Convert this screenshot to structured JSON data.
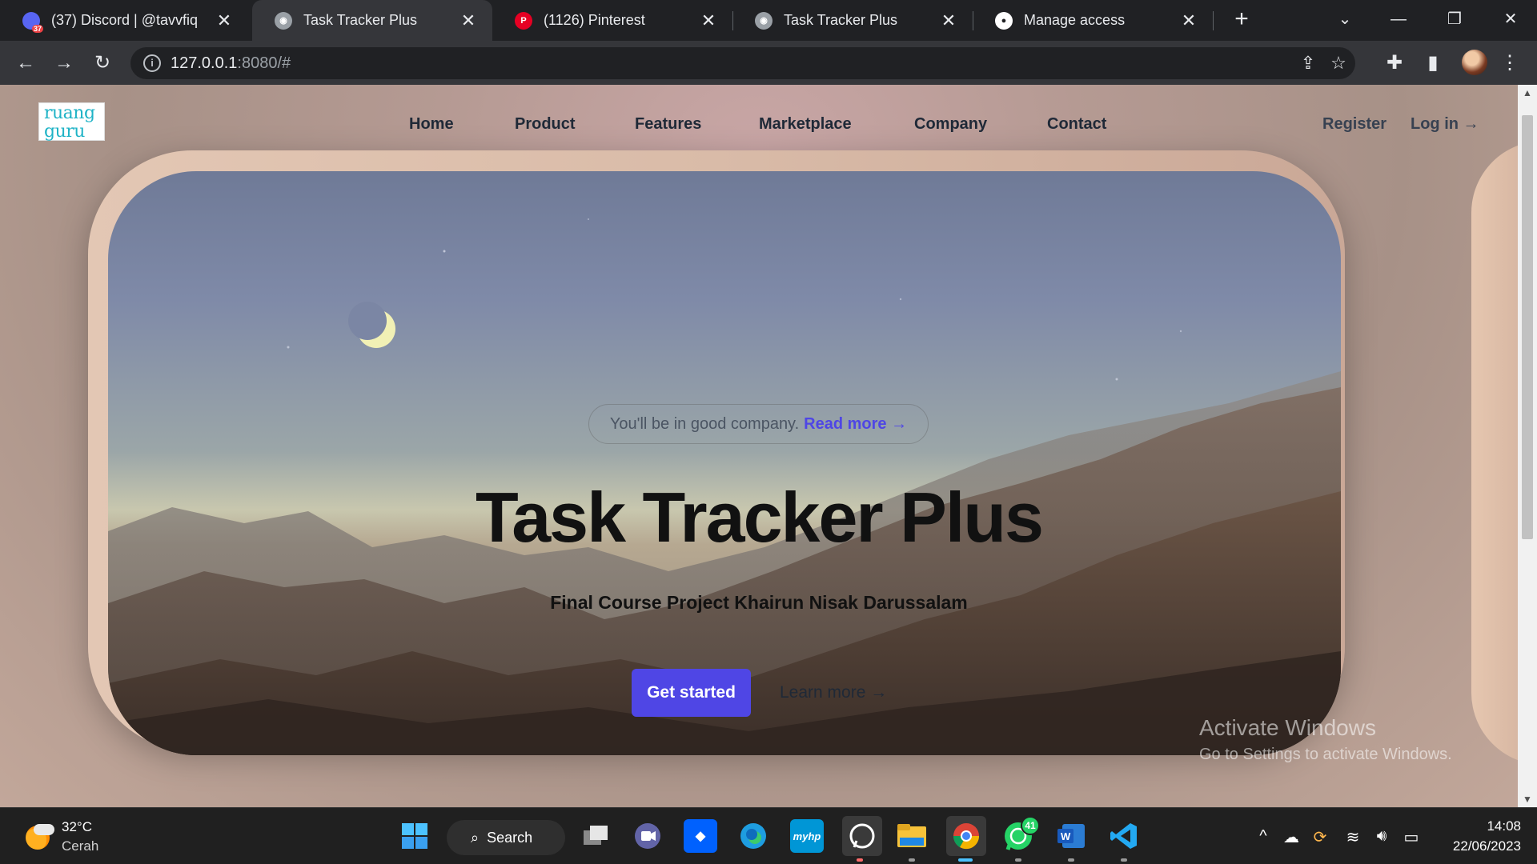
{
  "browser": {
    "tabs": [
      {
        "title": "(37) Discord | @tavvfiq",
        "favicon_badge": "37",
        "favicon_color": "#5865f2"
      },
      {
        "title": "Task Tracker Plus",
        "favicon_color": "#9aa0a6"
      },
      {
        "title": "(1126) Pinterest",
        "favicon_color": "#e60023",
        "favicon_glyph": "P"
      },
      {
        "title": "Task Tracker Plus",
        "favicon_color": "#9aa0a6"
      },
      {
        "title": "Manage access",
        "favicon_color": "#ffffff"
      }
    ],
    "active_tab": 1,
    "url_host": "127.0.0.1",
    "url_rest": ":8080/#"
  },
  "site": {
    "logo": {
      "line1": "ruang",
      "line2": "guru"
    },
    "nav": [
      "Home",
      "Product",
      "Features",
      "Marketplace",
      "Company",
      "Contact"
    ],
    "register": "Register",
    "login": "Log in →",
    "announcement": {
      "text": "You'll be in good company.",
      "link": "Read more →"
    },
    "title": "Task Tracker Plus",
    "subtitle": "Final Course Project Khairun Nisak Darussalam",
    "cta_primary": "Get started",
    "cta_secondary": "Learn more →",
    "accent_color": "#4f46e5"
  },
  "watermark": {
    "line1": "Activate Windows",
    "line2": "Go to Settings to activate Windows."
  },
  "taskbar": {
    "weather": {
      "temp": "32°C",
      "desc": "Cerah"
    },
    "search_label": "Search",
    "whatsapp_badge": "41",
    "time": "14:08",
    "date": "22/06/2023"
  }
}
